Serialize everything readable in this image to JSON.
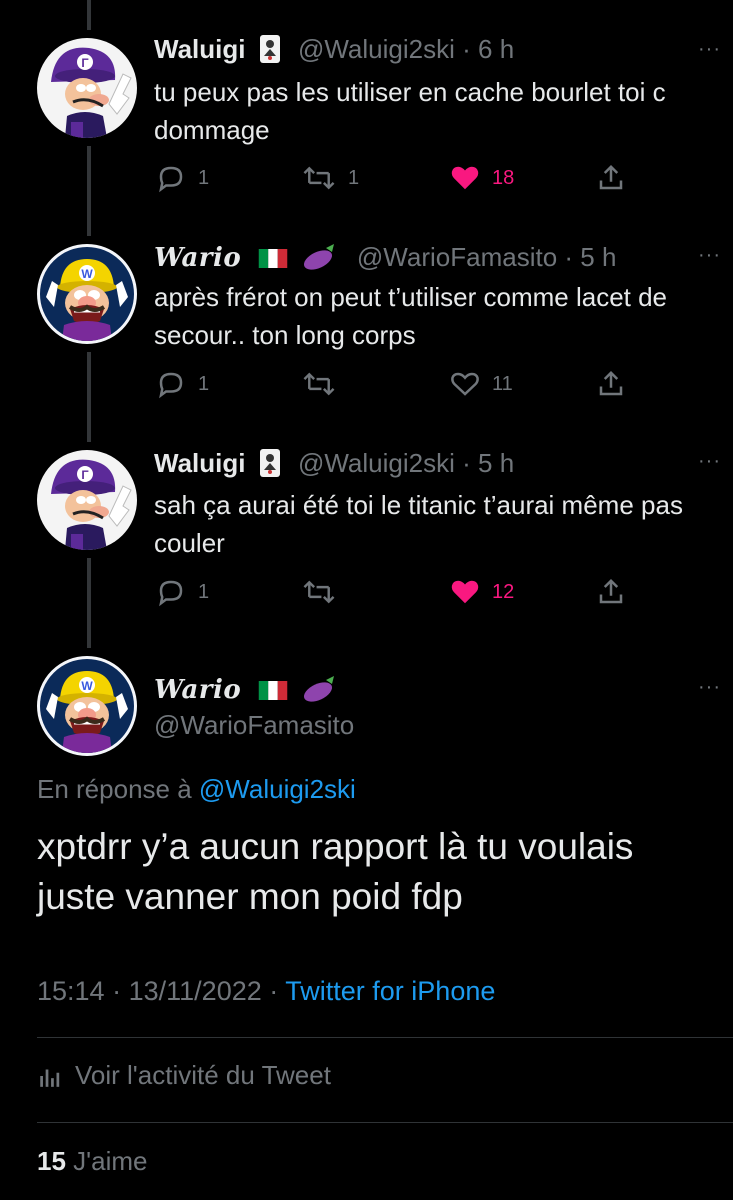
{
  "tweets": [
    {
      "name": "Waluigi",
      "handle": "@Waluigi2ski",
      "sep": "·",
      "time": "6 h",
      "text": "tu peux pas les utiliser en cache bourlet toi c dommage",
      "replies": "1",
      "retweets": "1",
      "likes": "18",
      "liked": true
    },
    {
      "name": "Wario",
      "handle": "@WarioFamasito",
      "sep": "·",
      "time": "5 h",
      "text": "après frérot on peut t’utiliser comme lacet de secour.. ton long corps",
      "replies": "1",
      "retweets": "",
      "likes": "11",
      "liked": false
    },
    {
      "name": "Waluigi",
      "handle": "@Waluigi2ski",
      "sep": "·",
      "time": "5 h",
      "text": "sah ça aurai été toi le titanic t’aurai même pas couler",
      "replies": "1",
      "retweets": "",
      "likes": "12",
      "liked": true
    }
  ],
  "main_tweet": {
    "name": "Wario",
    "handle": "@WarioFamasito",
    "reply_prefix": "En réponse à",
    "reply_mention": "@Waluigi2ski",
    "text": "xptdrr y’a aucun rapport là tu voulais juste vanner mon poid fdp",
    "time": "15:14",
    "sep1": "·",
    "date": "13/11/2022",
    "sep2": "·",
    "source": "Twitter for iPhone",
    "activity_label": "Voir l'activité du Tweet",
    "likes_count": "15",
    "likes_label": "J'aime"
  },
  "more_glyph": "···",
  "colors": {
    "background": "#000000",
    "text": "#e7e9ea",
    "secondary": "#71767b",
    "link": "#1d9bf0",
    "like": "#f91880",
    "divider": "#2f3336"
  },
  "icons": [
    "reply-icon",
    "retweet-icon",
    "like-icon",
    "share-icon",
    "more-icon",
    "joker-card-icon",
    "italy-flag-icon",
    "eggplant-icon",
    "analytics-icon"
  ]
}
